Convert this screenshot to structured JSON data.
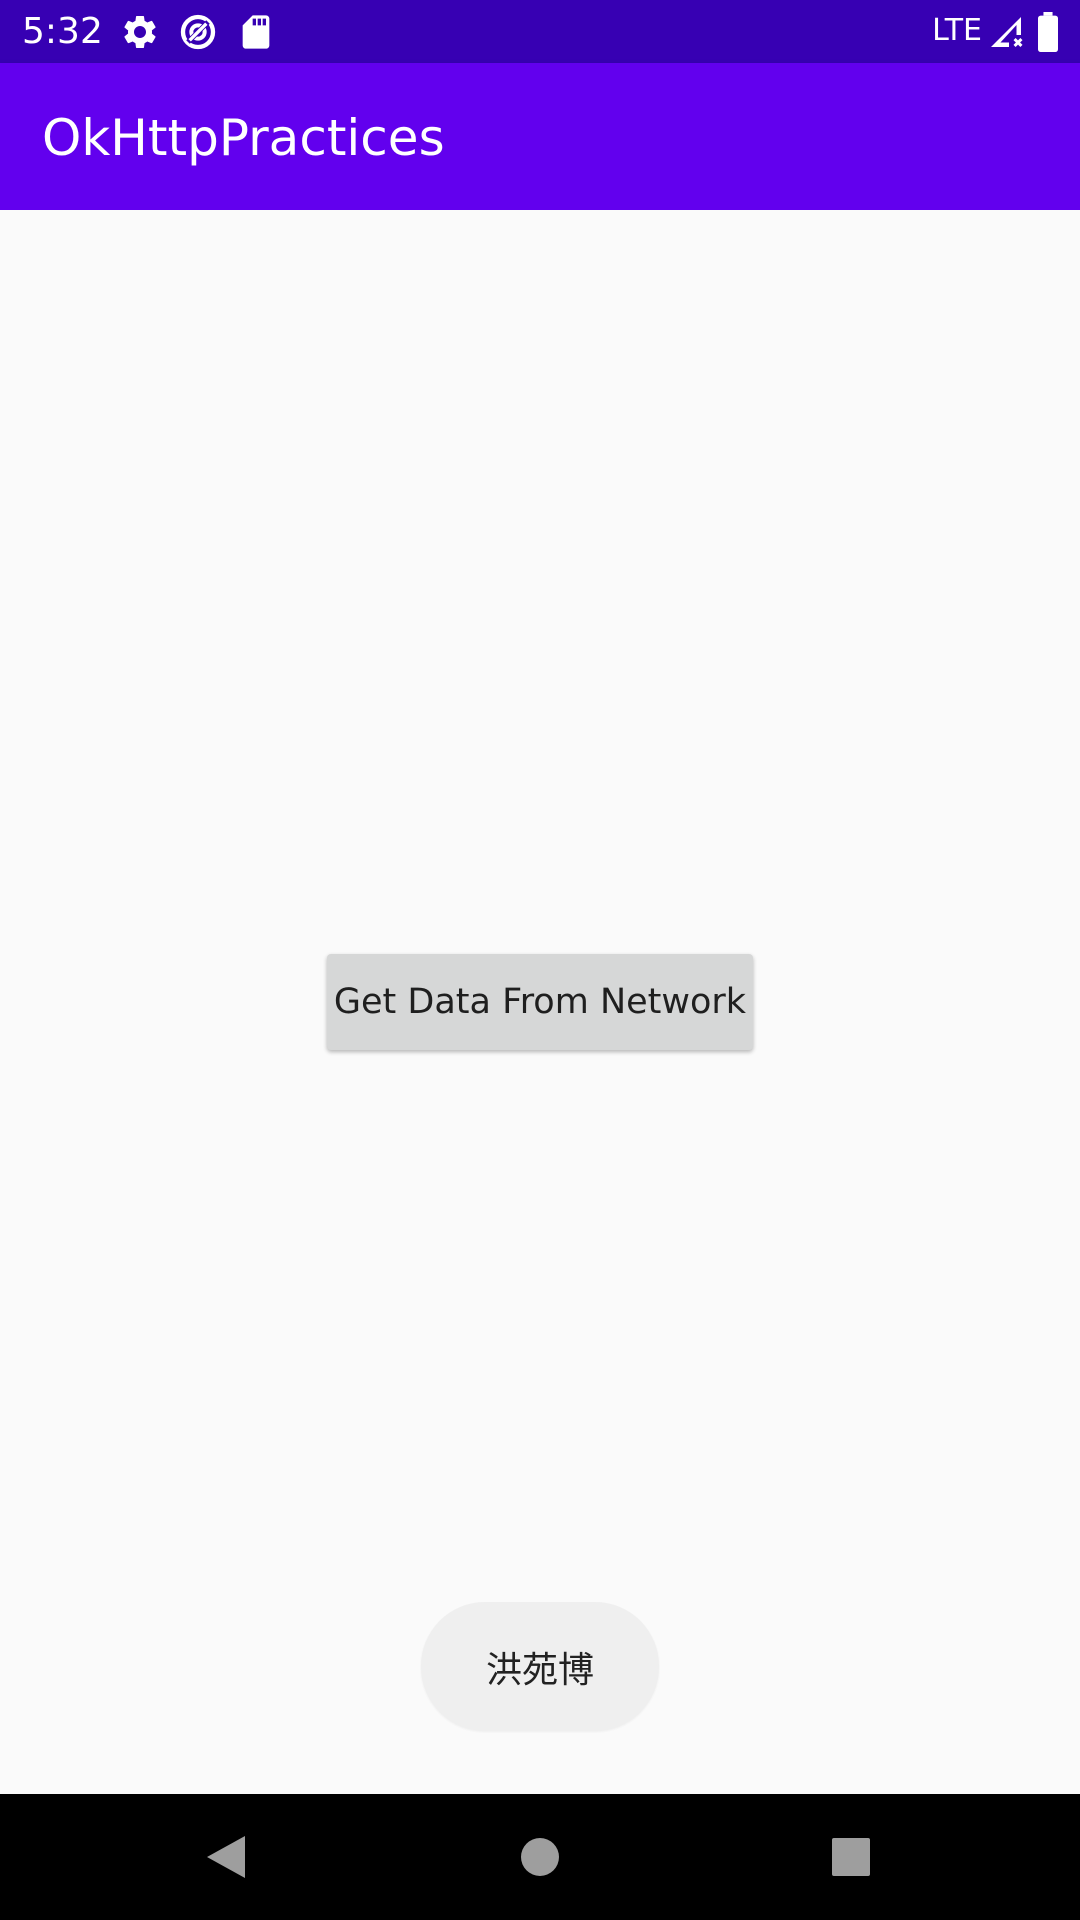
{
  "status_bar": {
    "time": "5:32",
    "network": "LTE",
    "icons": [
      "settings-icon",
      "data-saver-icon",
      "sd-card-icon",
      "signal-icon",
      "battery-icon"
    ],
    "background": "#3700b3"
  },
  "app_bar": {
    "title": "OkHttpPractices",
    "background": "#6200ee"
  },
  "main": {
    "button_label": "Get Data From Network",
    "button_color": "#d6d7d7"
  },
  "toast": {
    "text": "洪苑博"
  },
  "nav_bar": {
    "icons": [
      "back-icon",
      "home-icon",
      "recents-icon"
    ],
    "background": "#000000"
  }
}
